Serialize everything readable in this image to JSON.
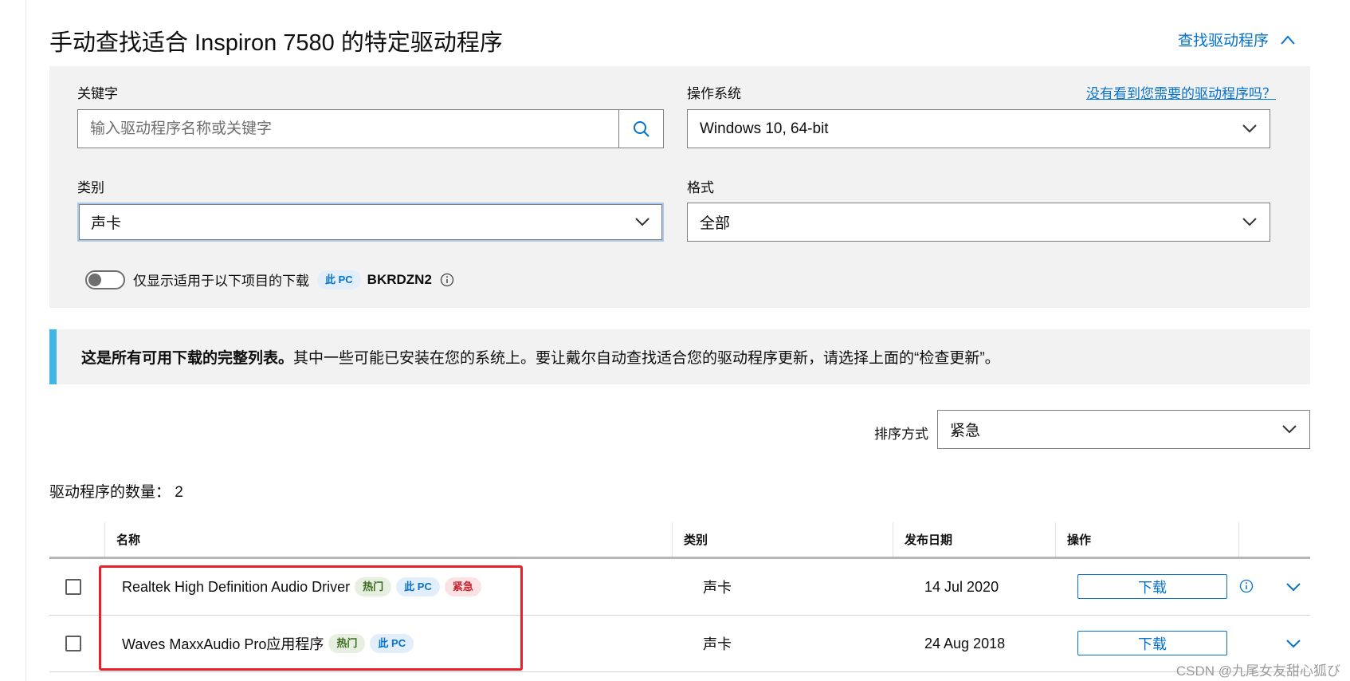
{
  "header": {
    "title": "手动查找适合 Inspiron 7580 的特定驱动程序",
    "find_drivers_link": "查找驱动程序"
  },
  "filters": {
    "keyword_label": "关键字",
    "keyword_placeholder": "输入驱动程序名称或关键字",
    "keyword_value": "",
    "os_label": "操作系统",
    "os_help_link": "没有看到您需要的驱动程序吗？",
    "os_value": "Windows 10, 64-bit",
    "category_label": "类别",
    "category_value": "声卡",
    "format_label": "格式",
    "format_value": "全部",
    "toggle_label": "仅显示适用于以下项目的下载",
    "toggle_on": false,
    "pc_tag": "此 PC",
    "service_tag": "BKRDZN2"
  },
  "notice": {
    "bold": "这是所有可用下载的完整列表。",
    "text": "其中一些可能已安装在您的系统上。要让戴尔自动查找适合您的驱动程序更新，请选择上面的“检查更新”。"
  },
  "sort": {
    "label": "排序方式",
    "value": "紧急"
  },
  "count": {
    "text": "驱动程序的数量：  2"
  },
  "table": {
    "headers": {
      "name": "名称",
      "category": "类别",
      "release_date": "发布日期",
      "action": "操作"
    },
    "rows": [
      {
        "name": "Realtek High Definition Audio Driver",
        "tag_hot": "热门",
        "tag_pc": "此 PC",
        "tag_urgent": "紧急",
        "category": "声卡",
        "date": "14 Jul 2020",
        "download": "下载"
      },
      {
        "name": "Waves MaxxAudio Pro应用程序",
        "tag_hot": "热门",
        "tag_pc": "此 PC",
        "category": "声卡",
        "date": "24 Aug 2018",
        "download": "下载"
      }
    ]
  },
  "watermark": "CSDN @九尾女友甜心狐び",
  "colors": {
    "link_blue": "#0672cb",
    "notice_accent": "#41b6e6",
    "highlight_red": "#e8202a",
    "panel_bg": "#f2f2f2"
  }
}
